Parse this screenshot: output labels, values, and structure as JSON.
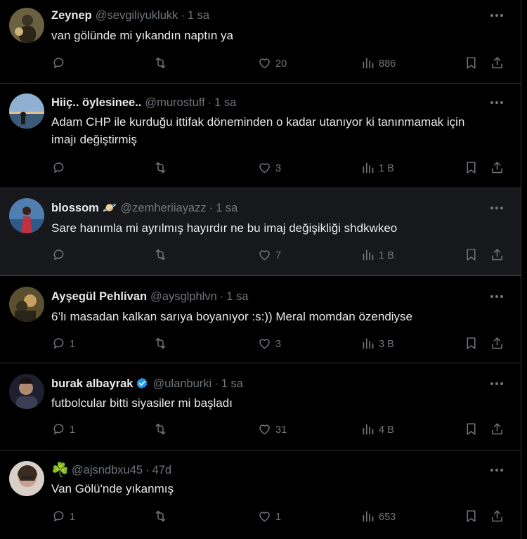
{
  "tweets": [
    {
      "name": "Zeynep",
      "handle": "@sevgiliyuklukk",
      "time": "1 sa",
      "text": "van gölünde mi yıkandın naptın ya",
      "replies": "",
      "likes": "20",
      "views": "886"
    },
    {
      "name": "Hiiç.. öylesinee..",
      "handle": "@murostuff",
      "time": "1 sa",
      "text": "Adam CHP ile kurduğu ittifak döneminden o kadar utanıyor ki tanınmamak için imajı değiştirmiş",
      "replies": "",
      "likes": "3",
      "views": "1 B"
    },
    {
      "name": "blossom",
      "name_emoji": "🪐",
      "handle": "@zemheriiayazz",
      "time": "1 sa",
      "text": "Sare hanımla mi ayrılmış hayırdır ne bu imaj değişikliği shdkwkeo",
      "replies": "",
      "likes": "7",
      "views": "1 B"
    },
    {
      "name": "Ayşegül Pehlivan",
      "handle": "@aysglphlvn",
      "time": "1 sa",
      "text": "6’lı masadan kalkan sarıya boyanıyor :s:)) Meral momdan özendiyse",
      "replies": "1",
      "likes": "3",
      "views": "3 B"
    },
    {
      "name": "burak albayrak",
      "verified": true,
      "handle": "@ulanburki",
      "time": "1 sa",
      "text": "futbolcular bitti siyasiler mi başladı",
      "replies": "1",
      "likes": "31",
      "views": "4 B"
    },
    {
      "name": "",
      "name_emoji": "☘️",
      "handle": "@ajsndbxu45",
      "time": "47d",
      "text": "Van Gölü'nde yıkanmış",
      "replies": "1",
      "likes": "1",
      "views": "653"
    }
  ],
  "icons": {
    "reply": "reply-icon",
    "retweet": "retweet-icon",
    "like": "heart-icon",
    "views": "views-icon",
    "bookmark": "bookmark-icon",
    "share": "share-icon",
    "more": "more-icon"
  },
  "colors": {
    "background": "#000000",
    "highlight": "#16181c",
    "text": "#e7e9ea",
    "muted": "#71767b",
    "divider": "#2f3336",
    "verified": "#1d9bf0"
  }
}
